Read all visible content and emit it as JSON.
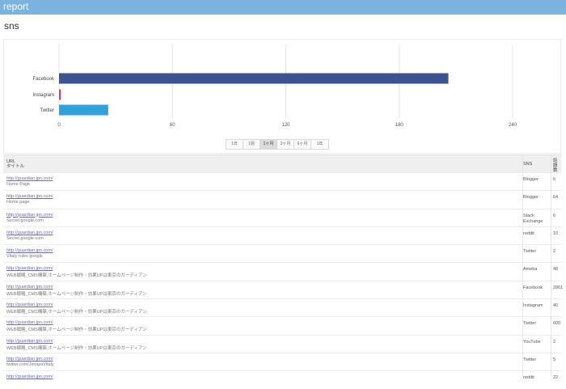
{
  "header": {
    "title": "report"
  },
  "section": {
    "title": "sns"
  },
  "chart_data": {
    "type": "bar",
    "orientation": "horizontal",
    "categories": [
      "Facebook",
      "Instagram",
      "Twitter"
    ],
    "values": [
      206,
      1,
      26
    ],
    "xlim": [
      0,
      240
    ],
    "xticks": [
      "0",
      "60",
      "120",
      "180",
      "240"
    ],
    "grid": true,
    "colors": [
      "#3d5293",
      "#d63f7a",
      "#2fa2dc"
    ]
  },
  "range_buttons": [
    {
      "label": "1日",
      "active": false
    },
    {
      "label": "1週",
      "active": false
    },
    {
      "label": "1ヶ月",
      "active": true
    },
    {
      "label": "3ヶ月",
      "active": false
    },
    {
      "label": "6ヶ月",
      "active": false
    },
    {
      "label": "1年",
      "active": false
    }
  ],
  "table": {
    "headers": {
      "url": "URL",
      "title": "タイトル",
      "sns": "SNS",
      "count": "話題数"
    },
    "rows": [
      {
        "url": "http://guardian.jpn.com/",
        "title": "Home Page",
        "sns": "Blogger",
        "count": "6"
      },
      {
        "url": "http://guardian.jpn.com/",
        "title": "Home page",
        "sns": "Blogger",
        "count": "64"
      },
      {
        "url": "http://guardian.jpn.com/",
        "title": "Secret.google.com",
        "sns": "Stack Exchange",
        "count": "6"
      },
      {
        "url": "http://guardian.jpn.com/",
        "title": "Secret.google.com",
        "sns": "reddit",
        "count": "10"
      },
      {
        "url": "http://guardian.jpn.com/",
        "title": "Vitaly rules google",
        "sns": "Twitter",
        "count": "2"
      },
      {
        "url": "http://guardian.jpn.com/",
        "title": "WEB戦略_CMS構築,ホームページ制作・効果UPは東京のガーディアン",
        "sns": "Ameba",
        "count": "48"
      },
      {
        "url": "http://guardian.jpn.com/",
        "title": "WEB戦略_CMS構築,ホームページ制作・効果UPは東京のガーディアン",
        "sns": "Facebook",
        "count": "2861"
      },
      {
        "url": "http://guardian.jpn.com/",
        "title": "WEB戦略_CMS構築,ホームページ制作・効果UPは東京のガーディアン",
        "sns": "Instagram",
        "count": "40"
      },
      {
        "url": "http://guardian.jpn.com/",
        "title": "WEB戦略_CMS構築,ホームページ制作・効果UPは東京のガーディアン",
        "sns": "Twitter",
        "count": "600"
      },
      {
        "url": "http://guardian.jpn.com/",
        "title": "WEB戦略_CMS構築,ホームページ制作・効果UPは東京のガーディアン",
        "sns": "YouTube",
        "count": "2"
      },
      {
        "url": "http://guardian.jpn.com/",
        "title": "twitter.com/JimapsVitaly",
        "sns": "Twitter",
        "count": "5"
      },
      {
        "url": "http://guardian.jpn.com/",
        "title": "",
        "sns": "reddit",
        "count": "22"
      }
    ]
  }
}
